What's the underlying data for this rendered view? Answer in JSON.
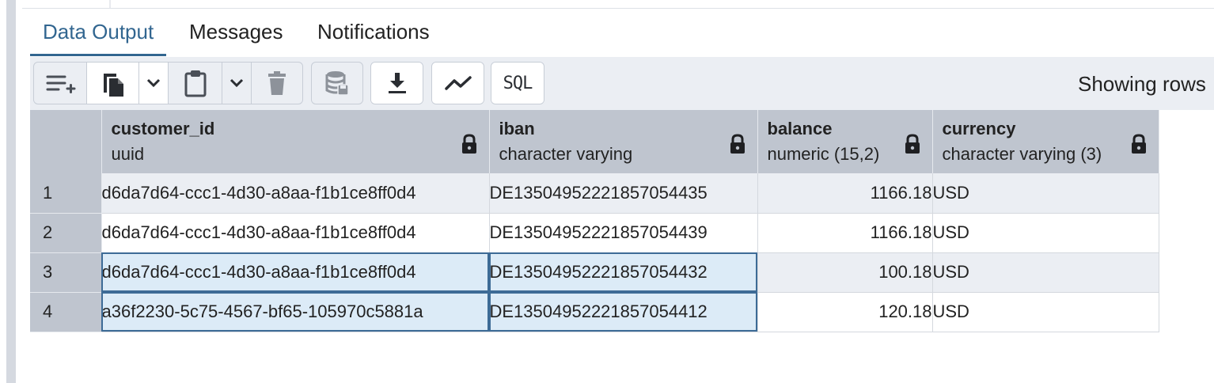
{
  "tabs": [
    {
      "label": "Data Output",
      "active": true
    },
    {
      "label": "Messages",
      "active": false
    },
    {
      "label": "Notifications",
      "active": false
    }
  ],
  "toolbar": {
    "buttons": [
      {
        "icon": "add-row-icon"
      },
      {
        "icon": "copy-icon"
      },
      {
        "icon": "chevron-down-icon"
      },
      {
        "icon": "paste-icon"
      },
      {
        "icon": "chevron-down-icon"
      },
      {
        "icon": "delete-icon"
      },
      {
        "icon": "save-data-icon"
      },
      {
        "icon": "download-icon"
      },
      {
        "icon": "graph-icon"
      },
      {
        "icon": "sql-icon",
        "label": "SQL"
      }
    ],
    "status": "Showing rows"
  },
  "grid": {
    "columns": [
      {
        "name": "customer_id",
        "type": "uuid",
        "icon": "lock-icon"
      },
      {
        "name": "iban",
        "type": "character varying",
        "icon": "lock-icon"
      },
      {
        "name": "balance",
        "type": "numeric (15,2)",
        "icon": "lock-icon"
      },
      {
        "name": "currency",
        "type": "character varying (3)",
        "icon": "lock-icon"
      }
    ],
    "rows": [
      {
        "num": "1",
        "customer_id": "d6da7d64-ccc1-4d30-a8aa-f1b1ce8ff0d4",
        "iban": "DE13504952221857054435",
        "balance": "1166.18",
        "currency": "USD"
      },
      {
        "num": "2",
        "customer_id": "d6da7d64-ccc1-4d30-a8aa-f1b1ce8ff0d4",
        "iban": "DE13504952221857054439",
        "balance": "1166.18",
        "currency": "USD"
      },
      {
        "num": "3",
        "customer_id": "d6da7d64-ccc1-4d30-a8aa-f1b1ce8ff0d4",
        "iban": "DE13504952221857054432",
        "balance": "100.18",
        "currency": "USD"
      },
      {
        "num": "4",
        "customer_id": "a36f2230-5c75-4567-bf65-105970c5881a",
        "iban": "DE13504952221857054412",
        "balance": "120.18",
        "currency": "USD"
      }
    ]
  },
  "colors": {
    "accent": "#326690",
    "toolbar_bg": "#ebeef3",
    "header_bg": "#bfc5cf",
    "selection_bg": "#dcebf7",
    "selection_border": "#3d6b96"
  }
}
